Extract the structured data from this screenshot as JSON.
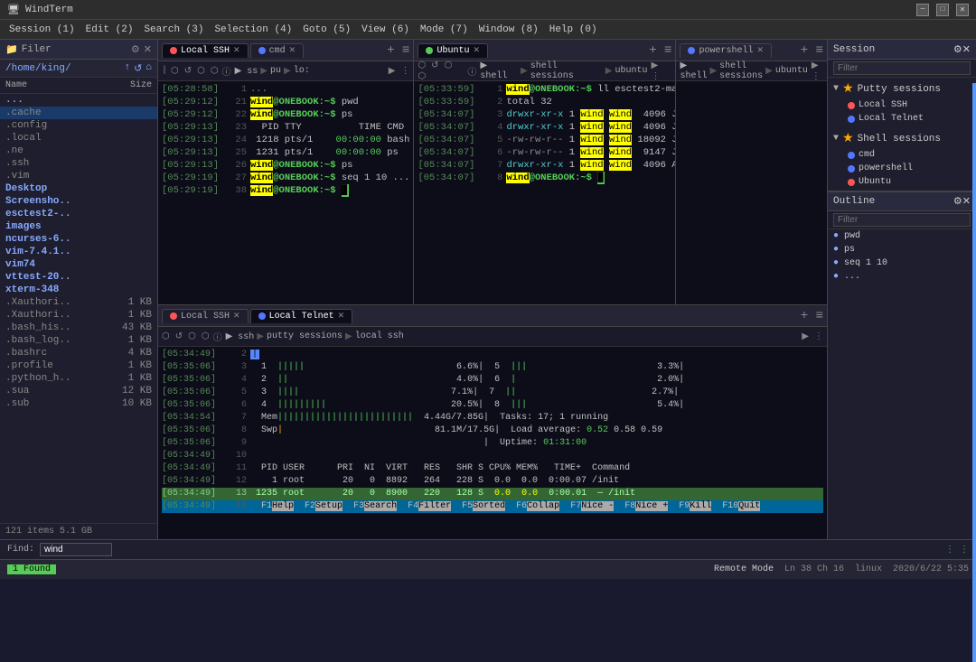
{
  "titlebar": {
    "title": "WindTerm",
    "controls": [
      "minimize",
      "maximize",
      "close"
    ]
  },
  "menubar": {
    "items": [
      "Session (1)",
      "Edit (2)",
      "Search (3)",
      "Selection (4)",
      "Goto (5)",
      "View (6)",
      "Mode (7)",
      "Window (8)",
      "Help (0)"
    ]
  },
  "filepanel": {
    "title": "Filer",
    "path": "/home/king/",
    "cols": [
      "Name",
      "Size"
    ],
    "files": [
      {
        "name": "...",
        "type": "dir",
        "size": ""
      },
      {
        "name": ".cache",
        "type": "hidden-dir",
        "size": ""
      },
      {
        "name": ".config",
        "type": "hidden-dir",
        "size": ""
      },
      {
        "name": ".local",
        "type": "hidden-dir",
        "size": ""
      },
      {
        "name": ".ne",
        "type": "hidden-dir",
        "size": ""
      },
      {
        "name": ".ssh",
        "type": "hidden-dir",
        "size": ""
      },
      {
        "name": ".vim",
        "type": "hidden-dir",
        "size": ""
      },
      {
        "name": "Desktop",
        "type": "dir",
        "size": ""
      },
      {
        "name": "Screensho..",
        "type": "dir",
        "size": ""
      },
      {
        "name": "esctest2-..",
        "type": "dir",
        "size": ""
      },
      {
        "name": "images",
        "type": "dir",
        "size": ""
      },
      {
        "name": "ncurses-6..",
        "type": "dir",
        "size": ""
      },
      {
        "name": "vim-7.4.1..",
        "type": "dir",
        "size": ""
      },
      {
        "name": "vim74",
        "type": "dir",
        "size": ""
      },
      {
        "name": "vttest-20..",
        "type": "dir",
        "size": ""
      },
      {
        "name": "xterm-348",
        "type": "dir",
        "size": ""
      },
      {
        "name": ".Xauthori..",
        "type": "hidden",
        "size": "1 KB"
      },
      {
        "name": ".Xauthori..",
        "type": "hidden",
        "size": "1 KB"
      },
      {
        "name": ".bash_his..",
        "type": "hidden",
        "size": "43 KB"
      },
      {
        "name": ".bash_log..",
        "type": "hidden",
        "size": "1 KB"
      },
      {
        "name": ".bashrc",
        "type": "hidden",
        "size": "4 KB"
      },
      {
        "name": ".profile",
        "type": "hidden",
        "size": "1 KB"
      },
      {
        "name": ".python_h..",
        "type": "hidden",
        "size": "1 KB"
      },
      {
        "name": ".sua",
        "type": "hidden",
        "size": "12 KB"
      },
      {
        "name": ".sub",
        "type": "hidden",
        "size": "10 KB"
      }
    ],
    "footer": "121 items  5.1 GB"
  },
  "sessions": {
    "putty_label": "Putty sessions",
    "shell_label": "Shell sessions",
    "putty_items": [
      {
        "name": "Local SSH",
        "color": "red"
      },
      {
        "name": "Local Telnet",
        "color": "blue"
      }
    ],
    "shell_items": [
      {
        "name": "cmd",
        "color": "blue"
      },
      {
        "name": "powershell",
        "color": "blue"
      },
      {
        "name": "Ubuntu",
        "color": "red"
      }
    ]
  },
  "outline": {
    "items": [
      "pwd",
      "ps",
      "seq 1 10",
      "..."
    ]
  },
  "tabs_top": [
    {
      "label": "Local SSH",
      "dot": "red",
      "active": false
    },
    {
      "label": "cmd",
      "dot": "blue",
      "active": false
    },
    {
      "label": "Ubuntu",
      "dot": "green",
      "active": false
    },
    {
      "label": "powershell",
      "dot": "blue",
      "active": true
    }
  ],
  "tabs_bottom": [
    {
      "label": "Local SSH",
      "dot": "red",
      "active": false
    },
    {
      "label": "Local Telnet",
      "dot": "blue",
      "active": true
    }
  ],
  "find": {
    "label": "Find:",
    "value": "wind",
    "status": "1 Found"
  },
  "statusbar": {
    "mode": "Remote Mode",
    "position": "Ln 38  Ch 16",
    "os": "linux",
    "datetime": "2020/6/22  5:35"
  }
}
